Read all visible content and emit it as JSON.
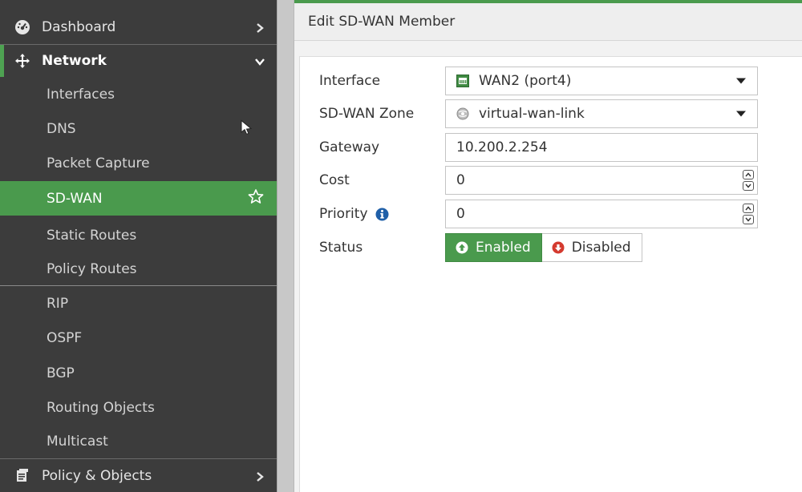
{
  "sidebar": {
    "dashboard": "Dashboard",
    "network": "Network",
    "items": [
      "Interfaces",
      "DNS",
      "Packet Capture",
      "SD-WAN",
      "Static Routes",
      "Policy Routes",
      "RIP",
      "OSPF",
      "BGP",
      "Routing Objects",
      "Multicast"
    ],
    "policy_objects": "Policy & Objects"
  },
  "header": {
    "title": "Edit SD-WAN Member"
  },
  "form": {
    "interface": {
      "label": "Interface",
      "value": "WAN2 (port4)"
    },
    "zone": {
      "label": "SD-WAN Zone",
      "value": "virtual-wan-link"
    },
    "gateway": {
      "label": "Gateway",
      "value": "10.200.2.254"
    },
    "cost": {
      "label": "Cost",
      "value": "0"
    },
    "priority": {
      "label": "Priority",
      "value": "0"
    },
    "status": {
      "label": "Status",
      "enabled": "Enabled",
      "disabled": "Disabled",
      "selected": "Enabled"
    }
  },
  "colors": {
    "sidebar_bg": "#3c3c3c",
    "accent_green": "#4a9a4d",
    "disabled_red": "#d43a2f",
    "info_blue": "#1f5fa8"
  }
}
